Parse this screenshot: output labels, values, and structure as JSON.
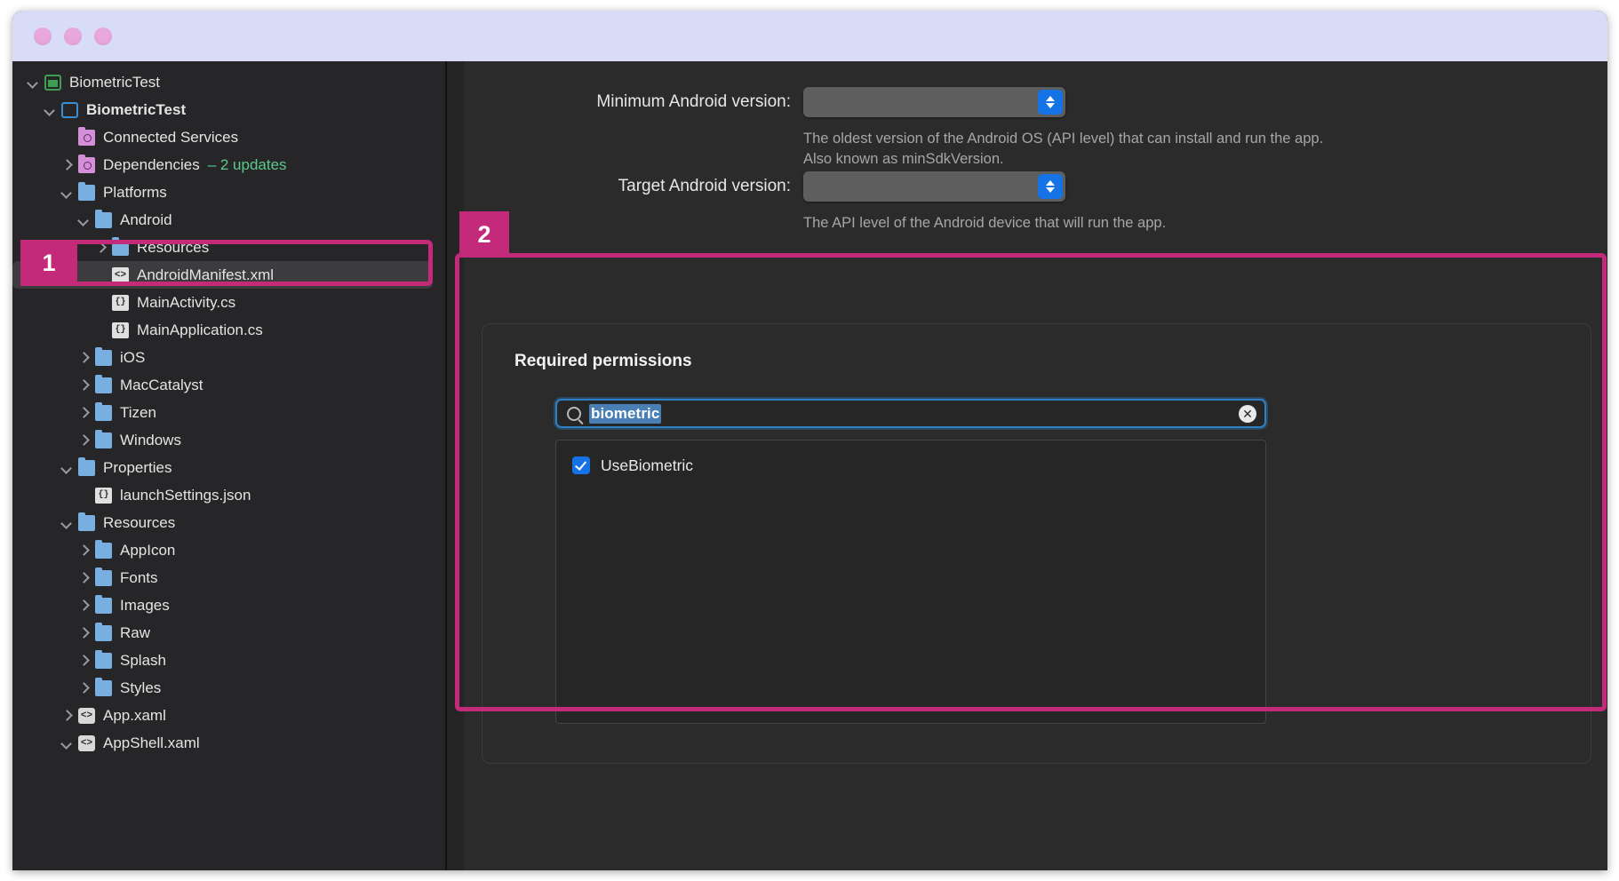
{
  "window": {
    "traffic_lights": [
      "close",
      "minimize",
      "zoom"
    ]
  },
  "sidebar": {
    "name": "solution-explorer",
    "items": [
      {
        "label": "BiometricTest",
        "indent": 0,
        "chevron": "down",
        "icon": "project-icon",
        "bold": false
      },
      {
        "label": "BiometricTest",
        "indent": 1,
        "chevron": "down",
        "icon": "csproj-icon",
        "bold": true
      },
      {
        "label": "Connected Services",
        "indent": 2,
        "chevron": "none",
        "icon": "services-icon",
        "bold": false
      },
      {
        "label": "Dependencies",
        "indent": 2,
        "chevron": "right",
        "icon": "packages-icon",
        "bold": false,
        "note": "– 2 updates"
      },
      {
        "label": "Platforms",
        "indent": 2,
        "chevron": "down",
        "icon": "folder-icon",
        "bold": false
      },
      {
        "label": "Android",
        "indent": 3,
        "chevron": "down",
        "icon": "folder-icon",
        "bold": false
      },
      {
        "label": "Resources",
        "indent": 4,
        "chevron": "right",
        "icon": "folder-icon",
        "bold": false
      },
      {
        "label": "AndroidManifest.xml",
        "indent": 4,
        "chevron": "none",
        "icon": "xml-file-icon",
        "bold": false,
        "selected": true
      },
      {
        "label": "MainActivity.cs",
        "indent": 4,
        "chevron": "none",
        "icon": "cs-file-icon",
        "bold": false
      },
      {
        "label": "MainApplication.cs",
        "indent": 4,
        "chevron": "none",
        "icon": "cs-file-icon",
        "bold": false
      },
      {
        "label": "iOS",
        "indent": 3,
        "chevron": "right",
        "icon": "folder-icon",
        "bold": false
      },
      {
        "label": "MacCatalyst",
        "indent": 3,
        "chevron": "right",
        "icon": "folder-icon",
        "bold": false
      },
      {
        "label": "Tizen",
        "indent": 3,
        "chevron": "right",
        "icon": "folder-icon",
        "bold": false
      },
      {
        "label": "Windows",
        "indent": 3,
        "chevron": "right",
        "icon": "folder-icon",
        "bold": false
      },
      {
        "label": "Properties",
        "indent": 2,
        "chevron": "down",
        "icon": "folder-icon",
        "bold": false
      },
      {
        "label": "launchSettings.json",
        "indent": 3,
        "chevron": "none",
        "icon": "json-file-icon",
        "bold": false
      },
      {
        "label": "Resources",
        "indent": 2,
        "chevron": "down",
        "icon": "folder-icon",
        "bold": false
      },
      {
        "label": "AppIcon",
        "indent": 3,
        "chevron": "right",
        "icon": "folder-icon",
        "bold": false
      },
      {
        "label": "Fonts",
        "indent": 3,
        "chevron": "right",
        "icon": "folder-icon",
        "bold": false
      },
      {
        "label": "Images",
        "indent": 3,
        "chevron": "right",
        "icon": "folder-icon",
        "bold": false
      },
      {
        "label": "Raw",
        "indent": 3,
        "chevron": "right",
        "icon": "folder-icon",
        "bold": false
      },
      {
        "label": "Splash",
        "indent": 3,
        "chevron": "right",
        "icon": "folder-icon",
        "bold": false
      },
      {
        "label": "Styles",
        "indent": 3,
        "chevron": "right",
        "icon": "folder-icon",
        "bold": false
      },
      {
        "label": "App.xaml",
        "indent": 2,
        "chevron": "right",
        "icon": "xaml-file-icon",
        "bold": false
      },
      {
        "label": "AppShell.xaml",
        "indent": 2,
        "chevron": "down",
        "icon": "xaml-file-icon",
        "bold": false
      }
    ]
  },
  "main": {
    "fields": [
      {
        "label": "Minimum Android version:",
        "value": "",
        "help": "The oldest version of the Android OS (API level) that can install and run the app. Also known as minSdkVersion."
      },
      {
        "label": "Target Android version:",
        "value": "",
        "help": "The API level of the Android device that will run the app."
      }
    ],
    "permissions": {
      "title": "Required permissions",
      "search_value": "biometric",
      "search_placeholder": "",
      "clear_glyph": "✕",
      "items": [
        {
          "label": "UseBiometric",
          "checked": true
        }
      ]
    }
  },
  "annotations": [
    {
      "number": "1",
      "target": "androidmanifest-xml-tree-item"
    },
    {
      "number": "2",
      "target": "required-permissions-panel"
    }
  ],
  "colors": {
    "accent_annotation": "#c42a7a",
    "accent_control": "#1573e6",
    "titlebar": "#d9dcf7",
    "traffic_light": "#e9a8dd",
    "note_green": "#5cc98a",
    "folder_blue": "#79aee0"
  }
}
